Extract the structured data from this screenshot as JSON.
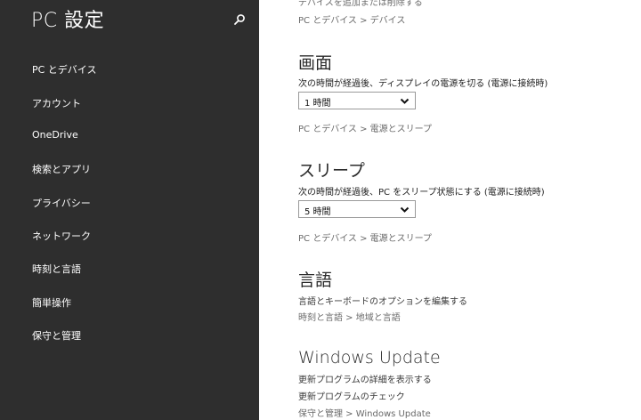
{
  "app": {
    "title": "PC 設定"
  },
  "sidebar": {
    "items": [
      {
        "label": "PC とデバイス"
      },
      {
        "label": "アカウント"
      },
      {
        "label": "OneDrive"
      },
      {
        "label": "検索とアプリ"
      },
      {
        "label": "プライバシー"
      },
      {
        "label": "ネットワーク"
      },
      {
        "label": "時刻と言語"
      },
      {
        "label": "簡単操作"
      },
      {
        "label": "保守と管理"
      }
    ]
  },
  "main": {
    "top_clipped_text": "デバイスを追加または削除する",
    "top_link": "PC とデバイス > デバイス",
    "screen": {
      "title": "画面",
      "description": "次の時間が経過後、ディスプレイの電源を切る (電源に接続時)",
      "selected": "1 時間",
      "link": "PC とデバイス > 電源とスリープ"
    },
    "sleep": {
      "title": "スリープ",
      "description": "次の時間が経過後、PC をスリープ状態にする (電源に接続時)",
      "selected": "5 時間",
      "link": "PC とデバイス > 電源とスリープ"
    },
    "language": {
      "title": "言語",
      "link1": "言語とキーボードのオプションを編集する",
      "link2": "時刻と言語 > 地域と言語"
    },
    "windows_update": {
      "title": "Windows Update",
      "link1": "更新プログラムの詳細を表示する",
      "link2": "更新プログラムのチェック",
      "link3": "保守と管理 > Windows Update"
    }
  },
  "colors": {
    "sidebar_bg": "#2e2e2e",
    "content_bg": "#ffffff"
  }
}
